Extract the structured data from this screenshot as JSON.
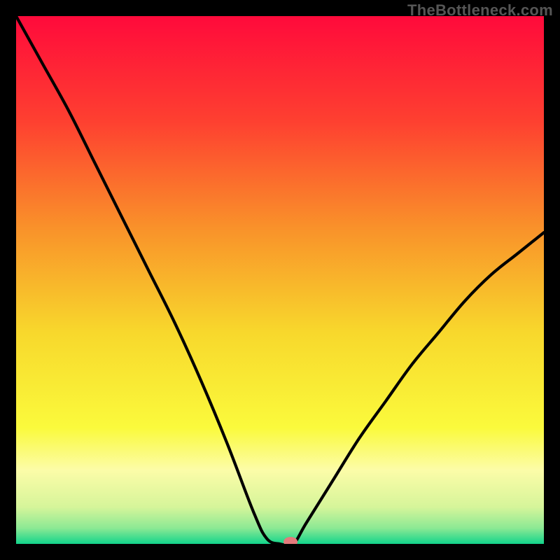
{
  "watermark": "TheBottleneck.com",
  "chart_data": {
    "type": "line",
    "title": "",
    "xlabel": "",
    "ylabel": "",
    "xlim": [
      0,
      100
    ],
    "ylim": [
      0,
      100
    ],
    "grid": false,
    "x": [
      0,
      5,
      10,
      15,
      20,
      25,
      30,
      35,
      40,
      45,
      47.5,
      50,
      52.5,
      55,
      60,
      65,
      70,
      75,
      80,
      85,
      90,
      95,
      100
    ],
    "values": [
      100,
      91,
      82,
      72,
      62,
      52,
      42,
      31,
      19,
      6,
      1,
      0,
      0,
      4,
      12,
      20,
      27,
      34,
      40,
      46,
      51,
      55,
      59
    ],
    "background": {
      "type": "vertical-gradient",
      "stops": [
        {
          "pos": 0.0,
          "color": "#FF0A3B"
        },
        {
          "pos": 0.2,
          "color": "#FE4030"
        },
        {
          "pos": 0.4,
          "color": "#F9912A"
        },
        {
          "pos": 0.6,
          "color": "#F8D82C"
        },
        {
          "pos": 0.78,
          "color": "#FAFA3C"
        },
        {
          "pos": 0.86,
          "color": "#FCFCA8"
        },
        {
          "pos": 0.93,
          "color": "#D6F59A"
        },
        {
          "pos": 0.97,
          "color": "#8CE994"
        },
        {
          "pos": 1.0,
          "color": "#12D48B"
        }
      ]
    },
    "marker": {
      "x": 52,
      "y": 0,
      "color": "#E47A7C"
    }
  }
}
